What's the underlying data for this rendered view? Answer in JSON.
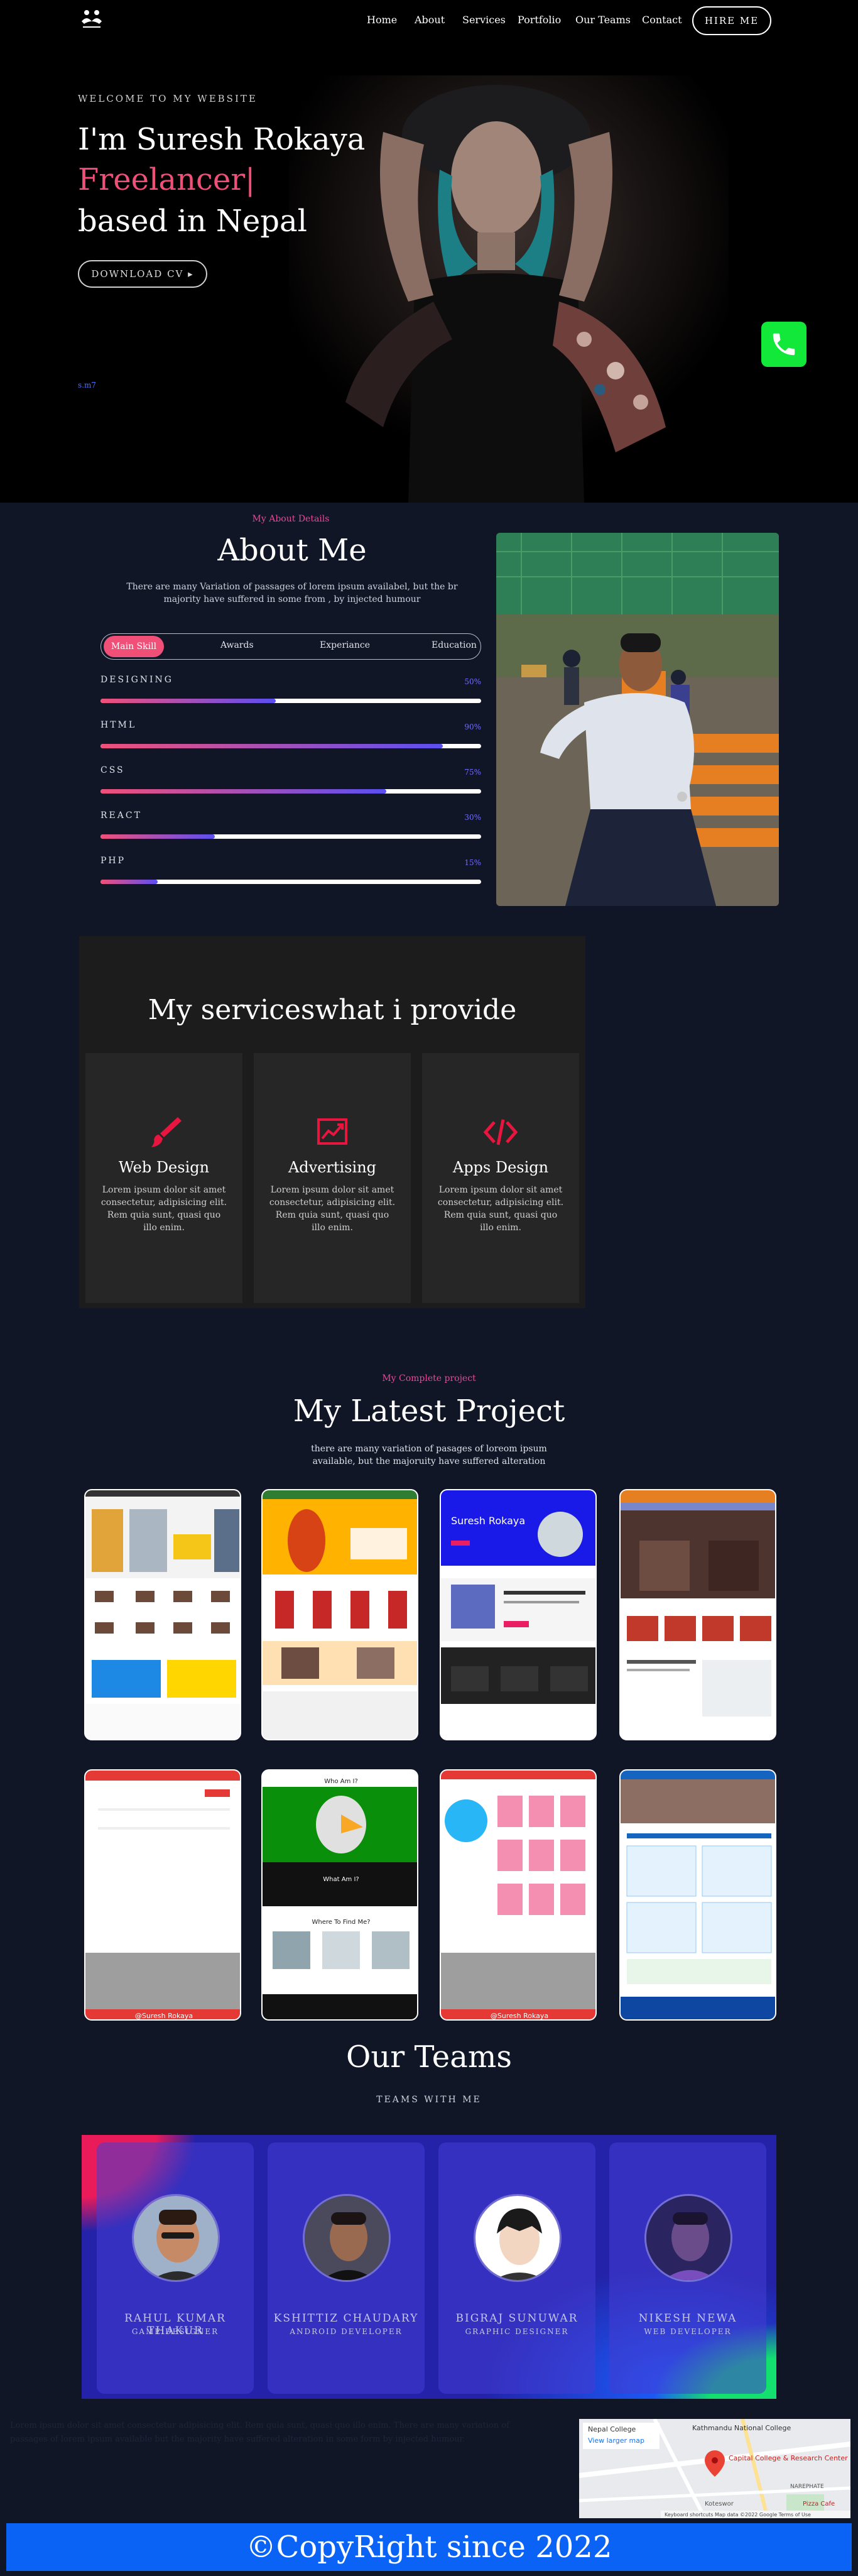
{
  "nav": {
    "links": [
      "Home",
      "About",
      "Services",
      "Portfolio",
      "Our Teams",
      "Contact"
    ],
    "hire": "HIRE ME"
  },
  "hero": {
    "welcome": "WELCOME TO MY WEBSITE",
    "line1": "I'm Suresh Rokaya",
    "line2": "Freelancer|",
    "line3": "based in Nepal",
    "download": "DOWNLOAD CV ▸",
    "tiny": "s.m7"
  },
  "about": {
    "eyebrow": "My About Details",
    "title": "About Me",
    "desc": "There are many Variation of passages of lorem ipsum availabel, but the br majority have suffered in some from , by injected humour",
    "tabs": [
      "Main Skill",
      "Awards",
      "Experiance",
      "Education"
    ],
    "skills": [
      {
        "name": "DESIGNING",
        "pct": "50%",
        "value": 0.46
      },
      {
        "name": "HTML",
        "pct": "90%",
        "value": 0.9
      },
      {
        "name": "CSS",
        "pct": "75%",
        "value": 0.75
      },
      {
        "name": "REACT",
        "pct": "30%",
        "value": 0.3
      },
      {
        "name": "PHP",
        "pct": "15%",
        "value": 0.15
      }
    ]
  },
  "services": {
    "title": "My serviceswhat i provide",
    "items": [
      {
        "title": "Web Design",
        "desc": "Lorem ipsum dolor sit amet consectetur, adipisicing elit. Rem quia sunt, quasi quo illo enim."
      },
      {
        "title": "Advertising",
        "desc": "Lorem ipsum dolor sit amet consectetur, adipisicing elit. Rem quia sunt, quasi quo illo enim."
      },
      {
        "title": "Apps Design",
        "desc": "Lorem ipsum dolor sit amet consectetur, adipisicing elit. Rem quia sunt, quasi quo illo enim."
      }
    ]
  },
  "projects": {
    "eyebrow": "My Complete project",
    "title": "My Latest Project",
    "desc": "there are many variation of pasages of loreom ipsum available, but the majoruity have suffered alteration",
    "thumb_texts": {
      "p3_name": "Suresh Rokaya",
      "p6_q1": "Who Am I?",
      "p6_q2": "What Am I?",
      "p6_q3": "Where To Find Me?",
      "p5_credit": "@Suresh Rokaya",
      "p7_credit": "@Suresh Rokaya"
    }
  },
  "teams": {
    "title": "Our Teams",
    "subtitle": "TEAMS WITH ME",
    "members": [
      {
        "name": "RAHUL KUMAR THAKUR",
        "role": "GAME DESIGNER"
      },
      {
        "name": "KSHITTIZ CHAUDARY",
        "role": "ANDROID DEVELOPER"
      },
      {
        "name": "BIGRAJ SUNUWAR",
        "role": "GRAPHIC DESIGNER"
      },
      {
        "name": "NIKESH NEWA",
        "role": "WEB DEVELOPER"
      }
    ]
  },
  "map": {
    "place1": "Kathmandu National College",
    "place2": "Capital College & Research Center",
    "larger": "View larger map",
    "nearby": "Nepal College",
    "area1": "NAREPHATE",
    "area2": "Koteswor",
    "area3": "Pizza Cafe",
    "credits": "Keyboard shortcuts  Map data ©2022 Google  Terms of Use"
  },
  "footer": {
    "faint": "Lorem ipsum dolor sit amet consectetur adipisicing elit. Rem quia sunt, quasi quo illo enim. There are many variation of passages of lorem ipsum available but the majority have suffered alteration in some form by injected humour.",
    "copyright": "©CopyRight since 2022"
  }
}
